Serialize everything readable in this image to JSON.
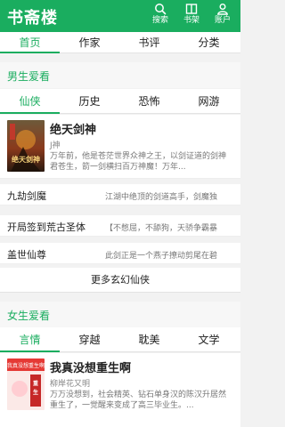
{
  "header": {
    "logo": "书斋楼",
    "buttons": [
      {
        "label": "搜索",
        "icon": "search-icon"
      },
      {
        "label": "书架",
        "icon": "bookshelf-icon"
      },
      {
        "label": "账户",
        "icon": "account-icon"
      }
    ]
  },
  "nav": {
    "items": [
      "首页",
      "作家",
      "书评",
      "分类"
    ],
    "active": "首页"
  },
  "male": {
    "title": "男生爱看",
    "tabs": [
      "仙侠",
      "历史",
      "恐怖",
      "网游"
    ],
    "active_tab": "仙侠",
    "featured": {
      "title": "绝天剑神",
      "author": "J神",
      "desc": "万年前，他是苍茫世界众神之王，以剑证道的剑神君苍生，箭一剑横扫百万神魔！万年...",
      "cover_text": "绝天剑神"
    },
    "list": [
      {
        "title": "九劫剑魔",
        "desc": "江湖中绝顶的剑道高手，剑魔独"
      },
      {
        "title": "开局签到荒古圣体",
        "desc": "【不憋屈，不舔狗，天骄争霸暴"
      },
      {
        "title": "盖世仙尊",
        "desc": "此剑正是一个燕子撩动剪尾在碧"
      }
    ],
    "more": "更多玄幻仙侠"
  },
  "female": {
    "title": "女生爱看",
    "tabs": [
      "言情",
      "穿越",
      "耽美",
      "文学"
    ],
    "active_tab": "言情",
    "featured": {
      "title": "我真没想重生啊",
      "author": "柳岸花又明",
      "desc": "万万没想到，社会精英、钻石单身汉的陈汉升居然重生了，一觉醒来变成了高三毕业生。...",
      "cover_text": "我真没想重生啊"
    }
  },
  "colors": {
    "accent": "#1aad5f"
  }
}
